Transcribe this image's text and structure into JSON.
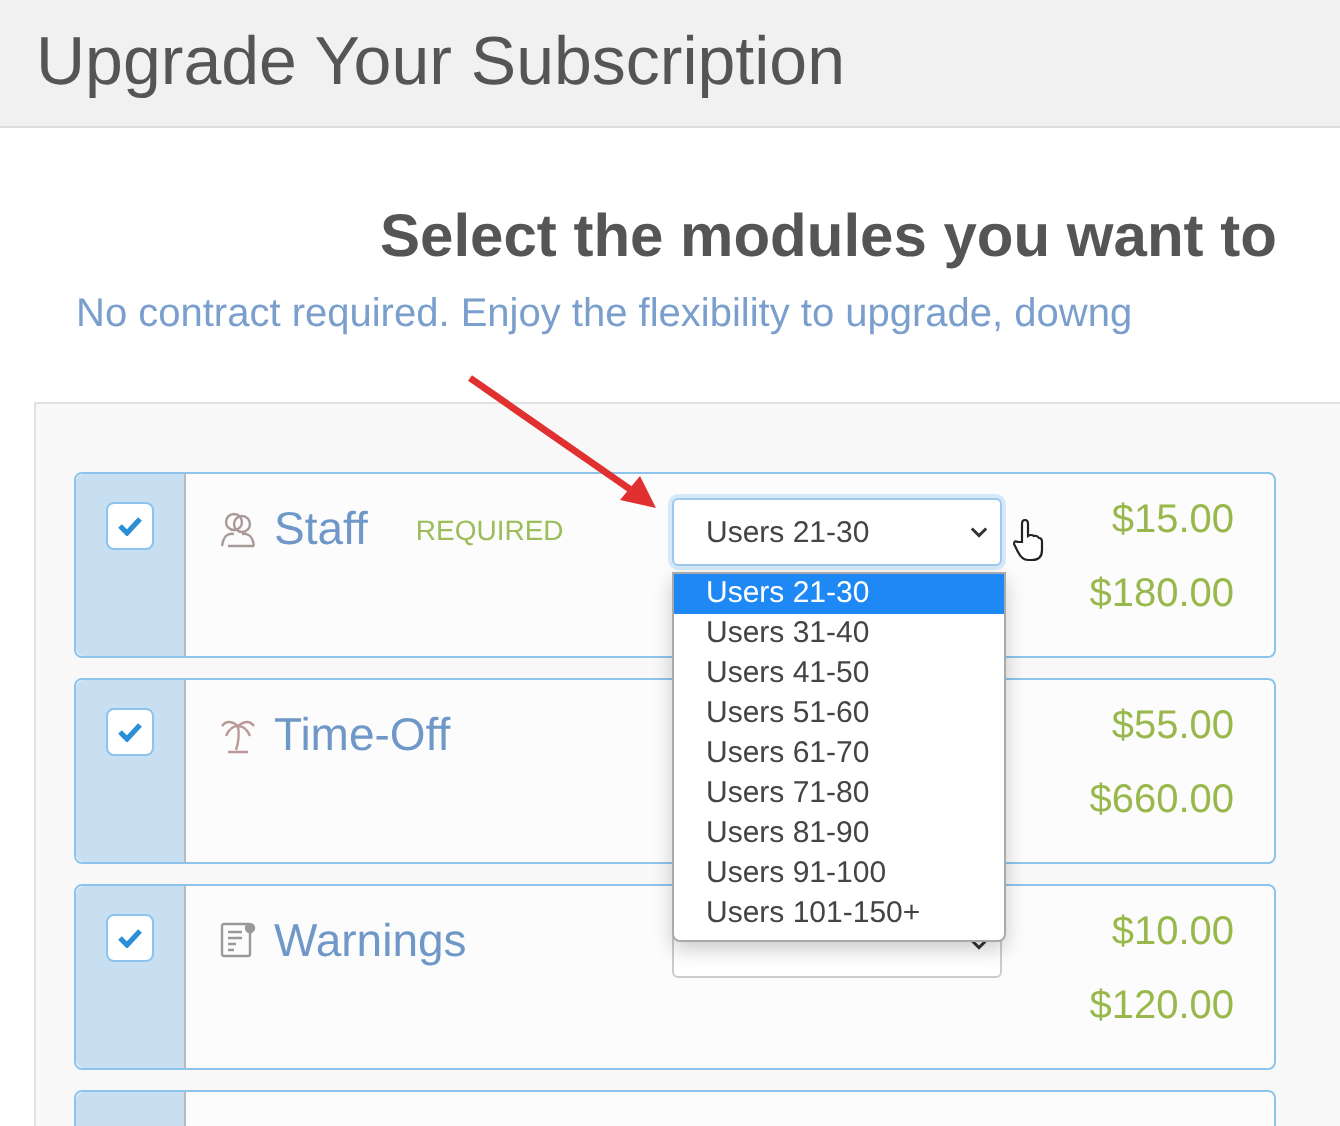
{
  "header": {
    "title": "Upgrade Your Subscription"
  },
  "heading": "Select the modules you want to",
  "subtitle": "No contract required. Enjoy the flexibility to upgrade, downg",
  "modules": [
    {
      "kind": "staff",
      "name": "Staff",
      "badge": "REQUIRED",
      "checked": true,
      "select": {
        "value": "Users 21-30",
        "open": true
      },
      "monthly": "$15.00",
      "yearly": "$180.00"
    },
    {
      "kind": "timeoff",
      "name": "Time-Off",
      "checked": true,
      "monthly": "$55.00",
      "yearly": "$660.00"
    },
    {
      "kind": "warnings",
      "name": "Warnings",
      "checked": true,
      "select": {
        "open": false
      },
      "monthly": "$10.00",
      "yearly": "$120.00"
    }
  ],
  "dropdown_options": [
    {
      "label": "Users 21-30",
      "selected": true
    },
    {
      "label": "Users 31-40",
      "selected": false
    },
    {
      "label": "Users 41-50",
      "selected": false
    },
    {
      "label": "Users 51-60",
      "selected": false
    },
    {
      "label": "Users 61-70",
      "selected": false
    },
    {
      "label": "Users 71-80",
      "selected": false
    },
    {
      "label": "Users 81-90",
      "selected": false
    },
    {
      "label": "Users 91-100",
      "selected": false
    },
    {
      "label": "Users 101-150+",
      "selected": false
    }
  ]
}
